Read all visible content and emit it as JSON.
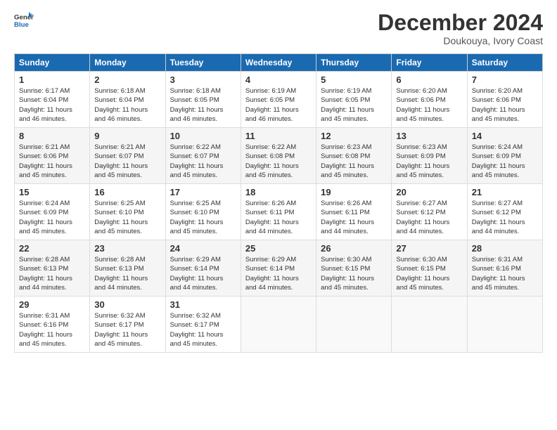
{
  "logo": {
    "line1": "General",
    "line2": "Blue"
  },
  "title": "December 2024",
  "location": "Doukouya, Ivory Coast",
  "header_days": [
    "Sunday",
    "Monday",
    "Tuesday",
    "Wednesday",
    "Thursday",
    "Friday",
    "Saturday"
  ],
  "weeks": [
    [
      {
        "day": "1",
        "sunrise": "6:17 AM",
        "sunset": "6:04 PM",
        "daylight": "11 hours and 46 minutes."
      },
      {
        "day": "2",
        "sunrise": "6:18 AM",
        "sunset": "6:04 PM",
        "daylight": "11 hours and 46 minutes."
      },
      {
        "day": "3",
        "sunrise": "6:18 AM",
        "sunset": "6:05 PM",
        "daylight": "11 hours and 46 minutes."
      },
      {
        "day": "4",
        "sunrise": "6:19 AM",
        "sunset": "6:05 PM",
        "daylight": "11 hours and 46 minutes."
      },
      {
        "day": "5",
        "sunrise": "6:19 AM",
        "sunset": "6:05 PM",
        "daylight": "11 hours and 45 minutes."
      },
      {
        "day": "6",
        "sunrise": "6:20 AM",
        "sunset": "6:06 PM",
        "daylight": "11 hours and 45 minutes."
      },
      {
        "day": "7",
        "sunrise": "6:20 AM",
        "sunset": "6:06 PM",
        "daylight": "11 hours and 45 minutes."
      }
    ],
    [
      {
        "day": "8",
        "sunrise": "6:21 AM",
        "sunset": "6:06 PM",
        "daylight": "11 hours and 45 minutes."
      },
      {
        "day": "9",
        "sunrise": "6:21 AM",
        "sunset": "6:07 PM",
        "daylight": "11 hours and 45 minutes."
      },
      {
        "day": "10",
        "sunrise": "6:22 AM",
        "sunset": "6:07 PM",
        "daylight": "11 hours and 45 minutes."
      },
      {
        "day": "11",
        "sunrise": "6:22 AM",
        "sunset": "6:08 PM",
        "daylight": "11 hours and 45 minutes."
      },
      {
        "day": "12",
        "sunrise": "6:23 AM",
        "sunset": "6:08 PM",
        "daylight": "11 hours and 45 minutes."
      },
      {
        "day": "13",
        "sunrise": "6:23 AM",
        "sunset": "6:09 PM",
        "daylight": "11 hours and 45 minutes."
      },
      {
        "day": "14",
        "sunrise": "6:24 AM",
        "sunset": "6:09 PM",
        "daylight": "11 hours and 45 minutes."
      }
    ],
    [
      {
        "day": "15",
        "sunrise": "6:24 AM",
        "sunset": "6:09 PM",
        "daylight": "11 hours and 45 minutes."
      },
      {
        "day": "16",
        "sunrise": "6:25 AM",
        "sunset": "6:10 PM",
        "daylight": "11 hours and 45 minutes."
      },
      {
        "day": "17",
        "sunrise": "6:25 AM",
        "sunset": "6:10 PM",
        "daylight": "11 hours and 45 minutes."
      },
      {
        "day": "18",
        "sunrise": "6:26 AM",
        "sunset": "6:11 PM",
        "daylight": "11 hours and 44 minutes."
      },
      {
        "day": "19",
        "sunrise": "6:26 AM",
        "sunset": "6:11 PM",
        "daylight": "11 hours and 44 minutes."
      },
      {
        "day": "20",
        "sunrise": "6:27 AM",
        "sunset": "6:12 PM",
        "daylight": "11 hours and 44 minutes."
      },
      {
        "day": "21",
        "sunrise": "6:27 AM",
        "sunset": "6:12 PM",
        "daylight": "11 hours and 44 minutes."
      }
    ],
    [
      {
        "day": "22",
        "sunrise": "6:28 AM",
        "sunset": "6:13 PM",
        "daylight": "11 hours and 44 minutes."
      },
      {
        "day": "23",
        "sunrise": "6:28 AM",
        "sunset": "6:13 PM",
        "daylight": "11 hours and 44 minutes."
      },
      {
        "day": "24",
        "sunrise": "6:29 AM",
        "sunset": "6:14 PM",
        "daylight": "11 hours and 44 minutes."
      },
      {
        "day": "25",
        "sunrise": "6:29 AM",
        "sunset": "6:14 PM",
        "daylight": "11 hours and 44 minutes."
      },
      {
        "day": "26",
        "sunrise": "6:30 AM",
        "sunset": "6:15 PM",
        "daylight": "11 hours and 45 minutes."
      },
      {
        "day": "27",
        "sunrise": "6:30 AM",
        "sunset": "6:15 PM",
        "daylight": "11 hours and 45 minutes."
      },
      {
        "day": "28",
        "sunrise": "6:31 AM",
        "sunset": "6:16 PM",
        "daylight": "11 hours and 45 minutes."
      }
    ],
    [
      {
        "day": "29",
        "sunrise": "6:31 AM",
        "sunset": "6:16 PM",
        "daylight": "11 hours and 45 minutes."
      },
      {
        "day": "30",
        "sunrise": "6:32 AM",
        "sunset": "6:17 PM",
        "daylight": "11 hours and 45 minutes."
      },
      {
        "day": "31",
        "sunrise": "6:32 AM",
        "sunset": "6:17 PM",
        "daylight": "11 hours and 45 minutes."
      },
      null,
      null,
      null,
      null
    ]
  ]
}
